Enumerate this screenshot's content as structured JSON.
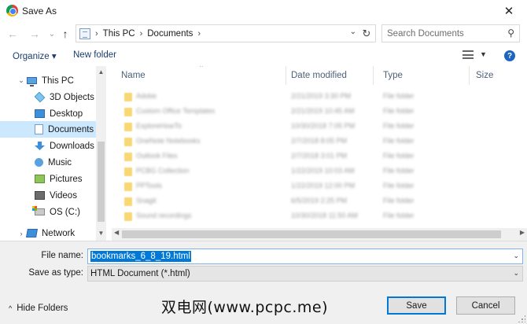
{
  "window": {
    "title": "Save As",
    "close_glyph": "✕"
  },
  "nav": {
    "back_glyph": "←",
    "forward_glyph": "→",
    "recent_glyph": "⌄",
    "up_glyph": "↑",
    "breadcrumb": [
      "This PC",
      "Documents"
    ],
    "refresh_glyph": "↻",
    "search_placeholder": "Search Documents"
  },
  "toolbar": {
    "organize": "Organize ▾",
    "new_folder": "New folder",
    "help": "?"
  },
  "sidebar": {
    "items": [
      {
        "label": "This PC",
        "icon": "pc-icon",
        "level": 0,
        "expand_glyph": "⌄"
      },
      {
        "label": "3D Objects",
        "icon": "cube-icon",
        "level": 1
      },
      {
        "label": "Desktop",
        "icon": "desktop-icon",
        "level": 1
      },
      {
        "label": "Documents",
        "icon": "documents-icon",
        "level": 1,
        "selected": true
      },
      {
        "label": "Downloads",
        "icon": "downloads-icon",
        "level": 1
      },
      {
        "label": "Music",
        "icon": "music-icon",
        "level": 1
      },
      {
        "label": "Pictures",
        "icon": "pictures-icon",
        "level": 1
      },
      {
        "label": "Videos",
        "icon": "videos-icon",
        "level": 1
      },
      {
        "label": "OS (C:)",
        "icon": "drive-icon",
        "level": 1
      },
      {
        "label": "Network",
        "icon": "network-icon",
        "level": 0,
        "expand_glyph": "›"
      }
    ]
  },
  "columns": {
    "name": "Name",
    "date": "Date modified",
    "type": "Type",
    "size": "Size",
    "sort_glyph": "^"
  },
  "files": [
    {
      "name": "Adobe",
      "date": "2/21/2019 3:30 PM",
      "type": "File folder"
    },
    {
      "name": "Custom Office Templates",
      "date": "2/21/2019 10:45 AM",
      "type": "File folder"
    },
    {
      "name": "ExploreHowTo",
      "date": "10/30/2018 7:05 PM",
      "type": "File folder"
    },
    {
      "name": "OneNote Notebooks",
      "date": "2/7/2018 8:05 PM",
      "type": "File folder"
    },
    {
      "name": "Outlook Files",
      "date": "2/7/2018 3:01 PM",
      "type": "File folder"
    },
    {
      "name": "PCBG Collection",
      "date": "1/22/2019 10:03 AM",
      "type": "File folder"
    },
    {
      "name": "PPTools",
      "date": "1/22/2019 12:00 PM",
      "type": "File folder"
    },
    {
      "name": "Snagit",
      "date": "6/5/2019 2:25 PM",
      "type": "File folder"
    },
    {
      "name": "Sound recordings",
      "date": "10/30/2018 11:50 AM",
      "type": "File folder"
    }
  ],
  "form": {
    "file_name_label": "File name:",
    "file_name_value": "bookmarks_6_8_19.html",
    "save_type_label": "Save as type:",
    "save_type_value": "HTML Document (*.html)",
    "dropdown_glyph": "⌄"
  },
  "footer": {
    "hide_folders": "Hide Folders",
    "hide_folders_glyph": "^",
    "watermark": "双电网(www.pcpc.me)",
    "save": "Save",
    "cancel": "Cancel"
  }
}
